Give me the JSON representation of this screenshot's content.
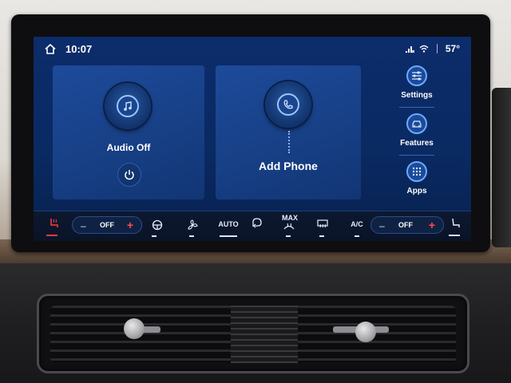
{
  "status_bar": {
    "time": "10:07",
    "temperature": "57°",
    "icons": [
      "home-icon",
      "no-signal-icon",
      "wifi-icon"
    ]
  },
  "cards": {
    "audio": {
      "label": "Audio Off",
      "icon": "music-note-icon",
      "button_icon": "power-icon"
    },
    "phone": {
      "label": "Add Phone",
      "icon": "phone-icon"
    }
  },
  "side_menu": {
    "items": [
      {
        "label": "Settings",
        "icon": "sliders-icon"
      },
      {
        "label": "Features",
        "icon": "car-icon"
      },
      {
        "label": "Apps",
        "icon": "grid-icon"
      }
    ]
  },
  "climate": {
    "left_fan": {
      "value": "OFF",
      "minus": "–",
      "plus": "+"
    },
    "right_fan": {
      "value": "OFF",
      "minus": "–",
      "plus": "+"
    },
    "auto_label": "AUTO",
    "max_label": "MAX",
    "ac_label": "A/C",
    "icons": [
      "heated-seat-icon",
      "steering-wheel-heat-icon",
      "fan-icon",
      "defrost-front-icon",
      "defrost-rear-icon",
      "recline-seat-icon"
    ],
    "colors": {
      "heat_indicator": "#ff3b3b",
      "plus": "#ff4d4d"
    }
  },
  "theme": {
    "screen_bg": "#0a2a63",
    "card_bg": "#174086",
    "accent": "#6fa9ff"
  }
}
